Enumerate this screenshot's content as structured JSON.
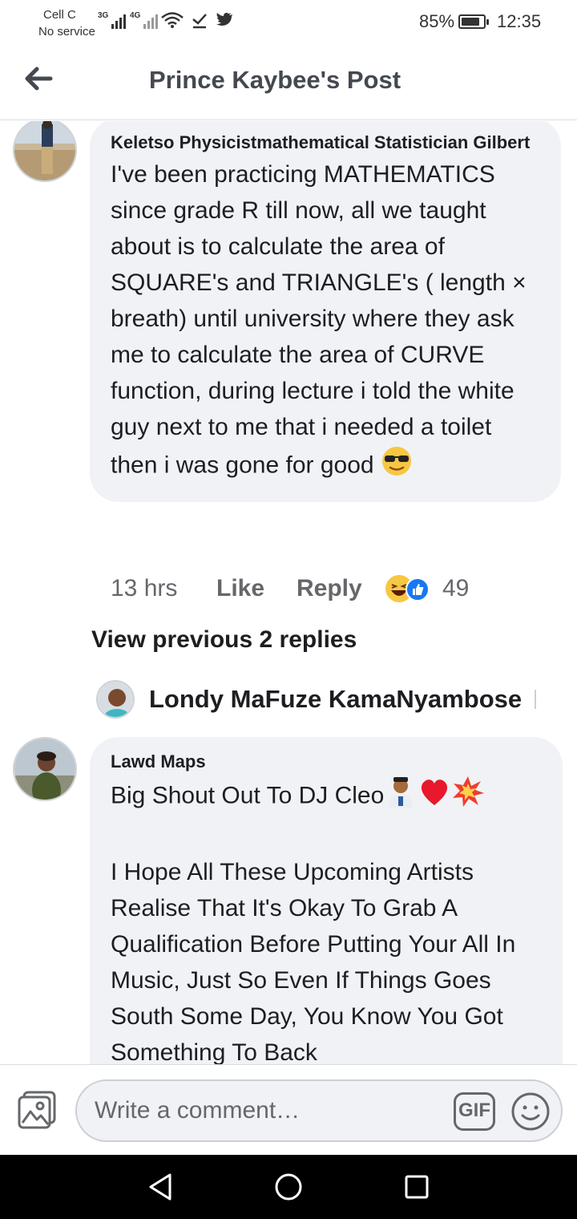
{
  "status_bar": {
    "carrier_name": "Cell C",
    "carrier_status": "No service",
    "signal_1_label": "3G",
    "signal_2_label": "4G",
    "battery_percent": "85%",
    "battery_level": 0.85,
    "time": "12:35",
    "icons": [
      "wifi-icon",
      "download-done-icon",
      "twitter-icon"
    ]
  },
  "header": {
    "back_icon": "arrow-left-icon",
    "title": "Prince Kaybee's Post"
  },
  "comments": [
    {
      "author": "Keletso Physicistmathematical Statistician Gilbert",
      "text": "I've been practicing MATHEMATICS since grade R till now, all we taught about is to calculate the area of SQUARE's and TRIANGLE's ( length × breath) until university where they ask me to calculate the area of CURVE function, during lecture i told the white guy next to me that i needed a toilet then i was gone for good",
      "emoji": "sunglasses-emoji",
      "time": "13 hrs",
      "like_label": "Like",
      "reply_label": "Reply",
      "reaction_icons": [
        "haha-reaction-icon",
        "like-reaction-icon"
      ],
      "reaction_count": "49"
    },
    {
      "author": "Lawd Maps",
      "text_line1": "Big Shout Out To DJ Cleo",
      "emojis": [
        "person-emoji",
        "red-heart-emoji",
        "collision-emoji"
      ],
      "text": "I Hope All These Upcoming Artists Realise That It's Okay To Grab A Qualification Before Putting Your All In Music, Just So Even If Things Goes South Some Day, You Know You Got Something To Back"
    }
  ],
  "view_previous_replies": "View previous 2 replies",
  "reply_preview": {
    "name": "Londy MaFuze KamaNyambose"
  },
  "composer": {
    "placeholder": "Write a comment…",
    "gif_label": "GIF"
  }
}
